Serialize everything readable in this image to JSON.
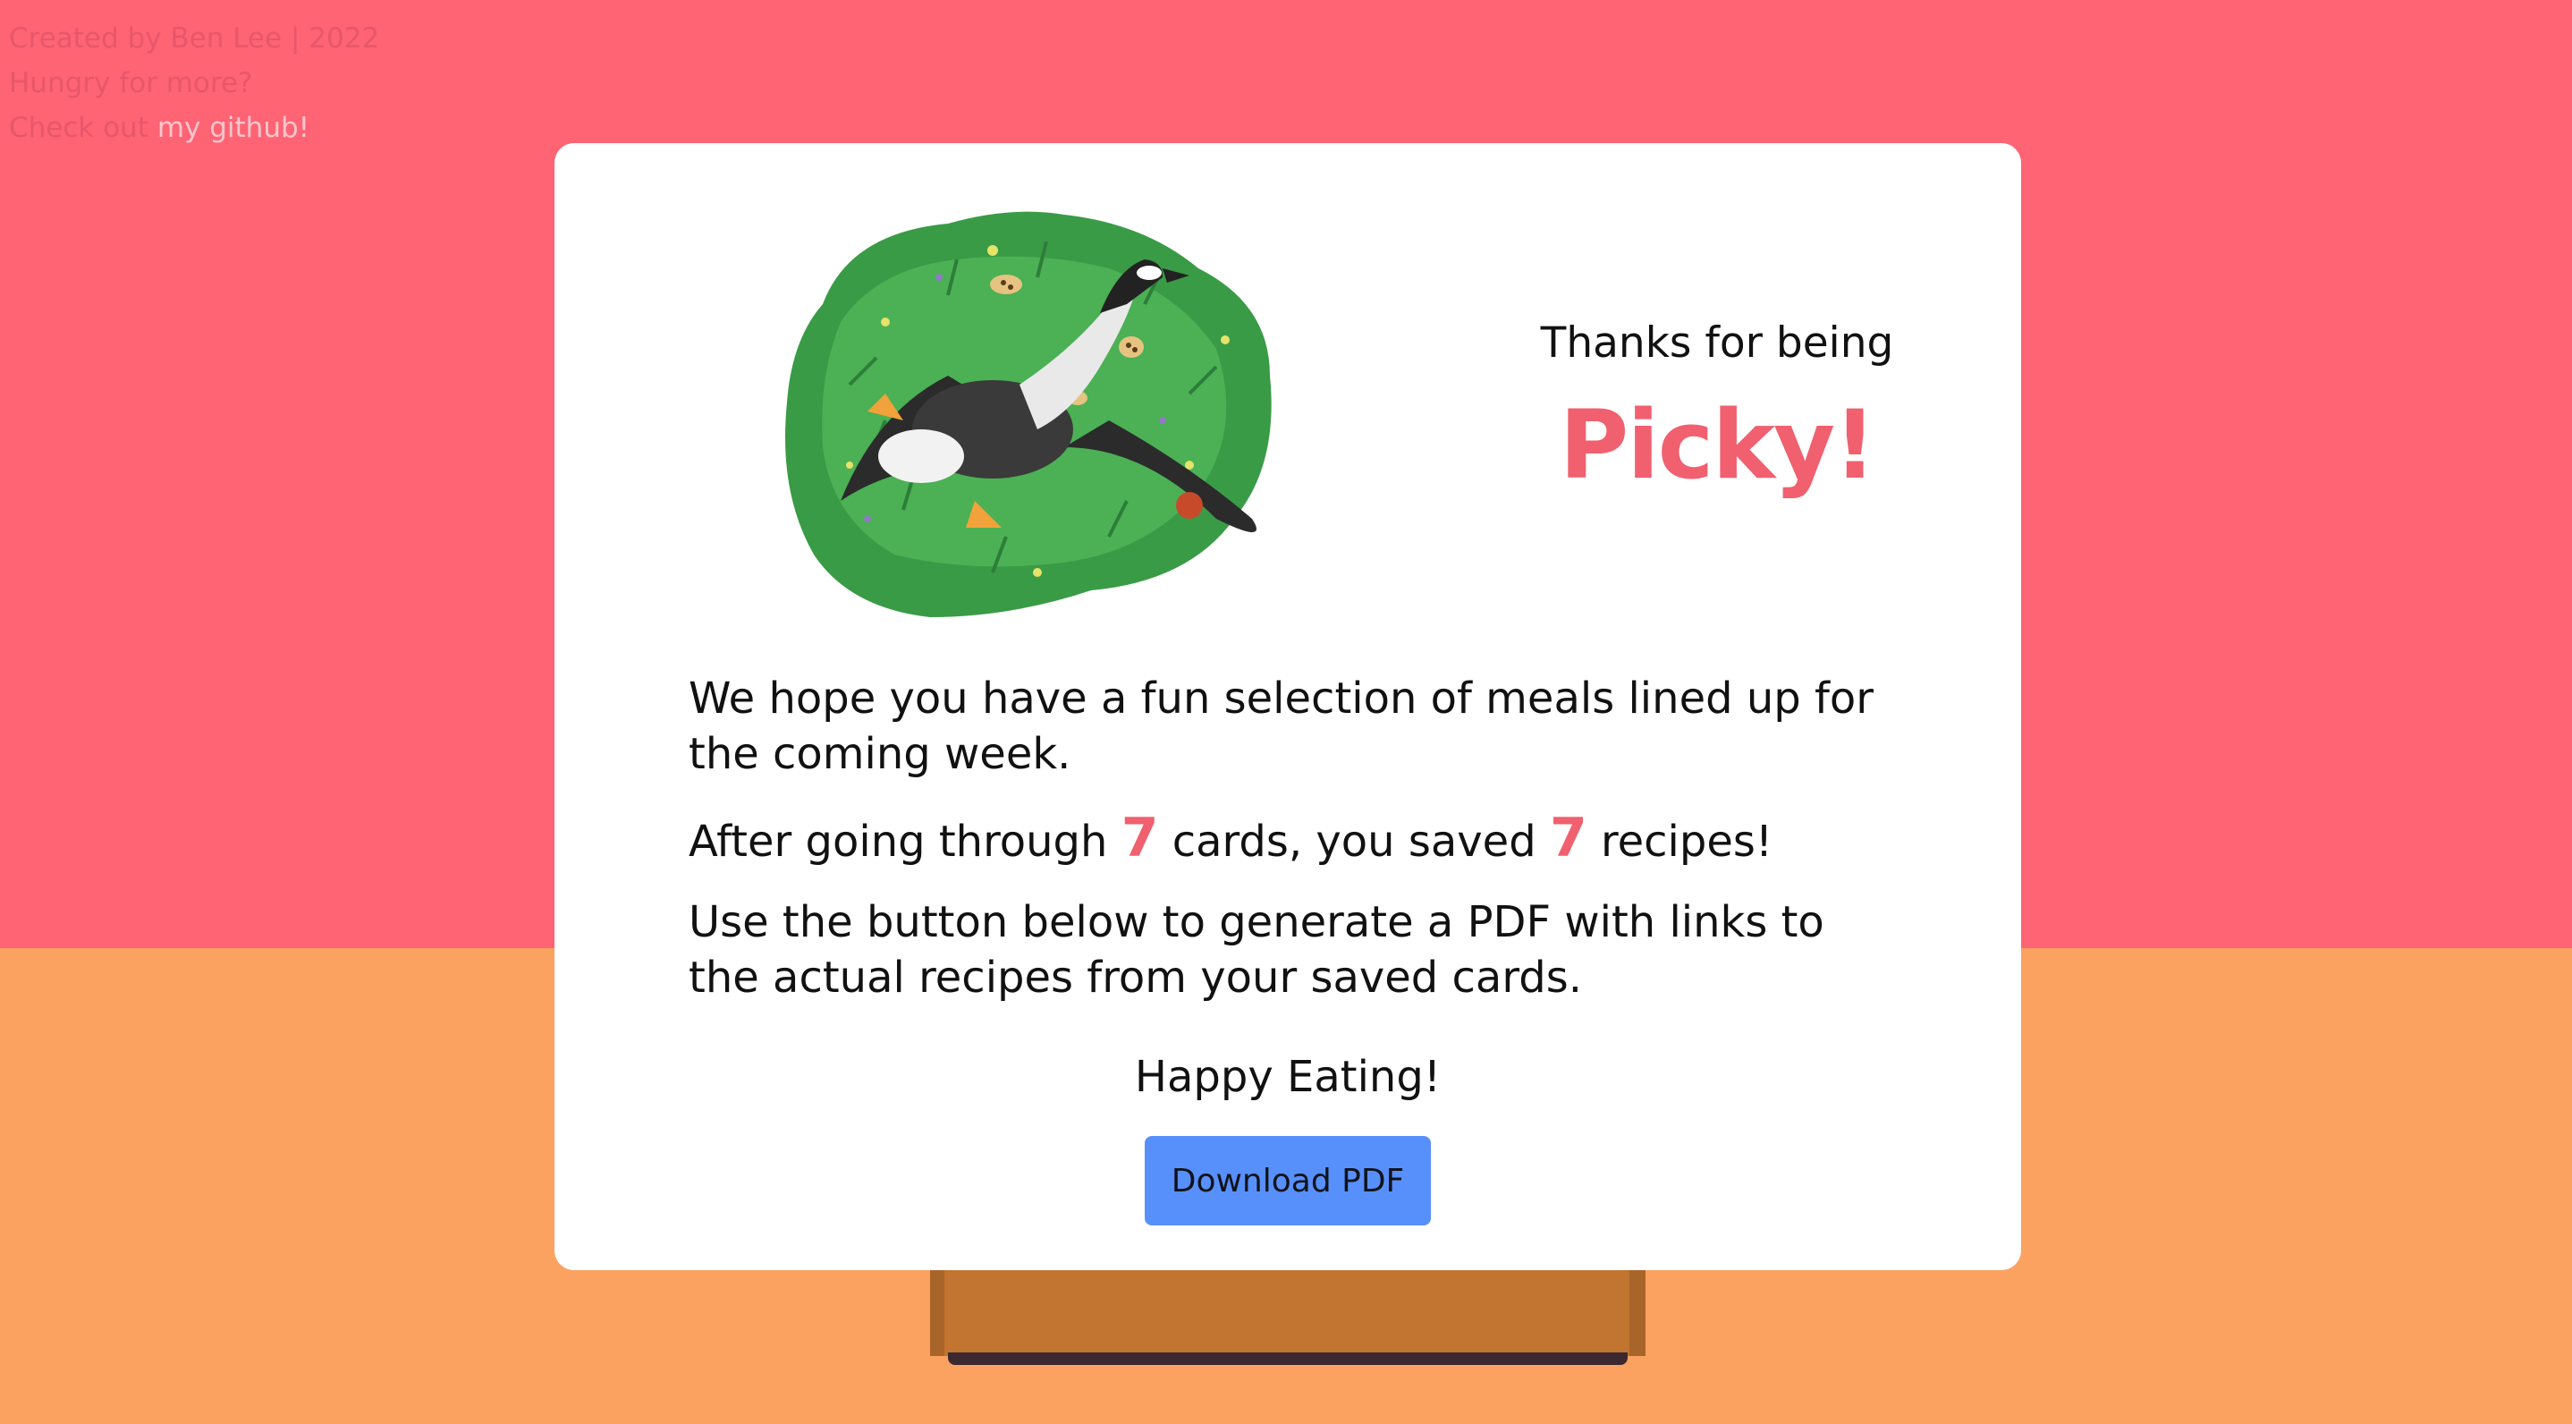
{
  "credits": {
    "line1": "Created by Ben Lee | 2022",
    "line2": "Hungry for more?",
    "line3_prefix": "Check out ",
    "github_link": "my github!"
  },
  "modal": {
    "thanks": "Thanks for being",
    "picky": "Picky!",
    "p1": "We hope you have a fun selection of meals lined up for the coming week.",
    "p2_a": "After going through ",
    "cards_count": "7",
    "p2_b": " cards, you saved ",
    "saved_count": "7",
    "p2_c": " recipes!",
    "p3": "Use the button below to generate a PDF with links to the actual recipes from your saved cards.",
    "happy": "Happy Eating!",
    "download_label": "Download PDF"
  },
  "colors": {
    "background_top": "#ff6474",
    "background_bottom": "#fba261",
    "accent": "#f0606f",
    "button": "#5890fb"
  },
  "icons": {
    "illustration": "goose-in-grass-illustration"
  }
}
